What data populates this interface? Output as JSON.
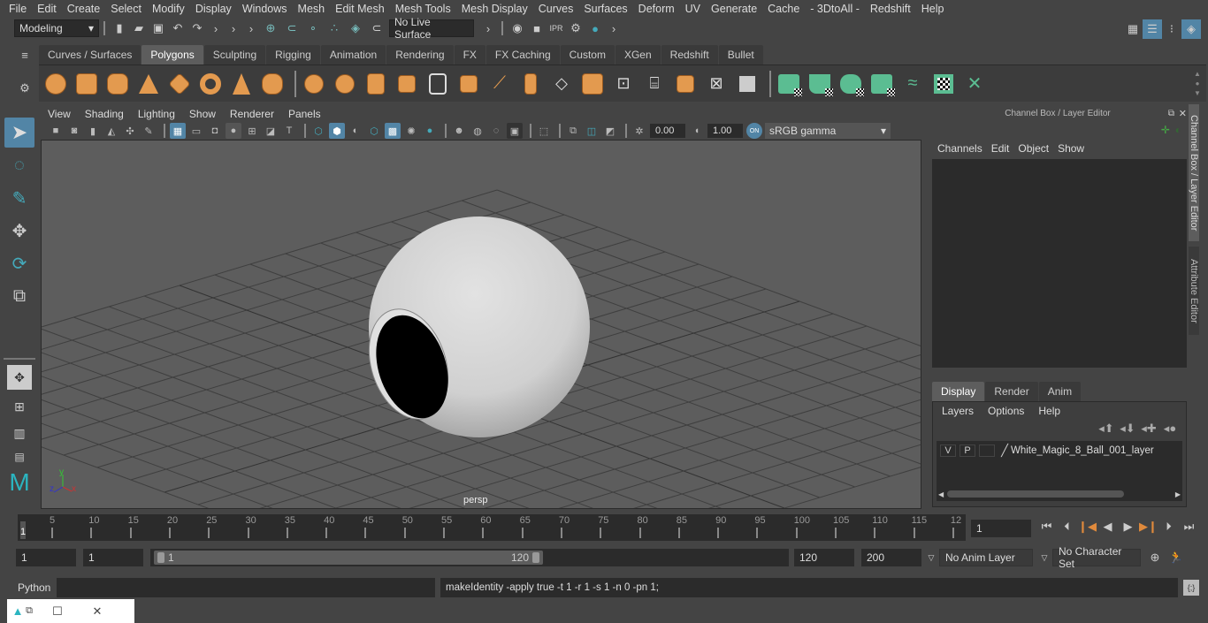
{
  "menu": [
    "File",
    "Edit",
    "Create",
    "Select",
    "Modify",
    "Display",
    "Windows",
    "Mesh",
    "Edit Mesh",
    "Mesh Tools",
    "Mesh Display",
    "Curves",
    "Surfaces",
    "Deform",
    "UV",
    "Generate",
    "Cache",
    "- 3DtoAll -",
    "Redshift",
    "Help"
  ],
  "status": {
    "mode": "Modeling",
    "live_surface": "No Live Surface"
  },
  "shelf_tabs": [
    "Curves / Surfaces",
    "Polygons",
    "Sculpting",
    "Rigging",
    "Animation",
    "Rendering",
    "FX",
    "FX Caching",
    "Custom",
    "XGen",
    "Redshift",
    "Bullet"
  ],
  "shelf_active": "Polygons",
  "viewport": {
    "menu": [
      "View",
      "Shading",
      "Lighting",
      "Show",
      "Renderer",
      "Panels"
    ],
    "exposure": "0.00",
    "gamma": "1.00",
    "color_mgmt": "ON",
    "color_space": "sRGB gamma",
    "camera_label": "persp",
    "axis": {
      "x": "x",
      "y": "y",
      "z": "z"
    }
  },
  "channel_box": {
    "title": "Channel Box / Layer Editor",
    "menu": [
      "Channels",
      "Edit",
      "Object",
      "Show"
    ]
  },
  "layer_editor": {
    "tabs": [
      "Display",
      "Render",
      "Anim"
    ],
    "active_tab": "Display",
    "menu": [
      "Layers",
      "Options",
      "Help"
    ],
    "layers": [
      {
        "v": "V",
        "p": "P",
        "name": "White_Magic_8_Ball_001_layer"
      }
    ]
  },
  "side_tabs": [
    "Channel Box / Layer Editor",
    "Attribute Editor"
  ],
  "timeline": {
    "ticks": [
      5,
      10,
      15,
      20,
      25,
      30,
      35,
      40,
      45,
      50,
      55,
      60,
      65,
      70,
      75,
      80,
      85,
      90,
      95,
      100,
      105,
      110,
      115,
      "12"
    ],
    "current_frame_marker": "1",
    "current_frame": "1"
  },
  "range": {
    "start": "1",
    "playback_start": "1",
    "range_start": "1",
    "range_end": "120",
    "playback_end": "120",
    "end": "200",
    "anim_layer": "No Anim Layer",
    "character_set": "No Character Set"
  },
  "command": {
    "lang": "Python",
    "output": "makeIdentity -apply true -t 1 -r 1 -s 1 -n 0 -pn 1;"
  },
  "colors": {
    "accent": "#5285a6",
    "shelf_orange": "#e39a4f",
    "shelf_green": "#5bbd92",
    "keyframe": "#e08a3c"
  }
}
